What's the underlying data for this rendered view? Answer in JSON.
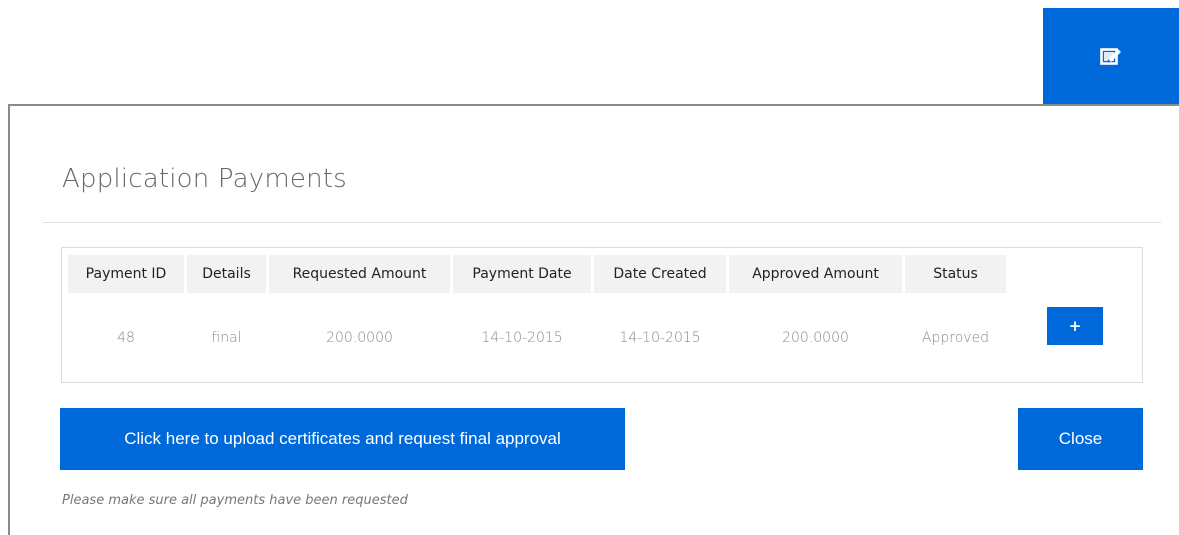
{
  "header": {
    "edit_icon": "edit-icon",
    "accent_color": "#0069d9"
  },
  "modal": {
    "title": "Application Payments",
    "table": {
      "columns": [
        "Payment ID",
        "Details",
        "Requested Amount",
        "Payment Date",
        "Date Created",
        "Approved Amount",
        "Status"
      ],
      "rows": [
        {
          "payment_id": "48",
          "details": "final",
          "requested_amount": "200.0000",
          "payment_date": "14-10-2015",
          "date_created": "14-10-2015",
          "approved_amount": "200.0000",
          "status": "Approved",
          "action_label": "+"
        }
      ]
    },
    "upload_button_label": "Click here to upload certificates and request final approval",
    "close_button_label": "Close",
    "note": "Please make sure all payments have been requested"
  }
}
